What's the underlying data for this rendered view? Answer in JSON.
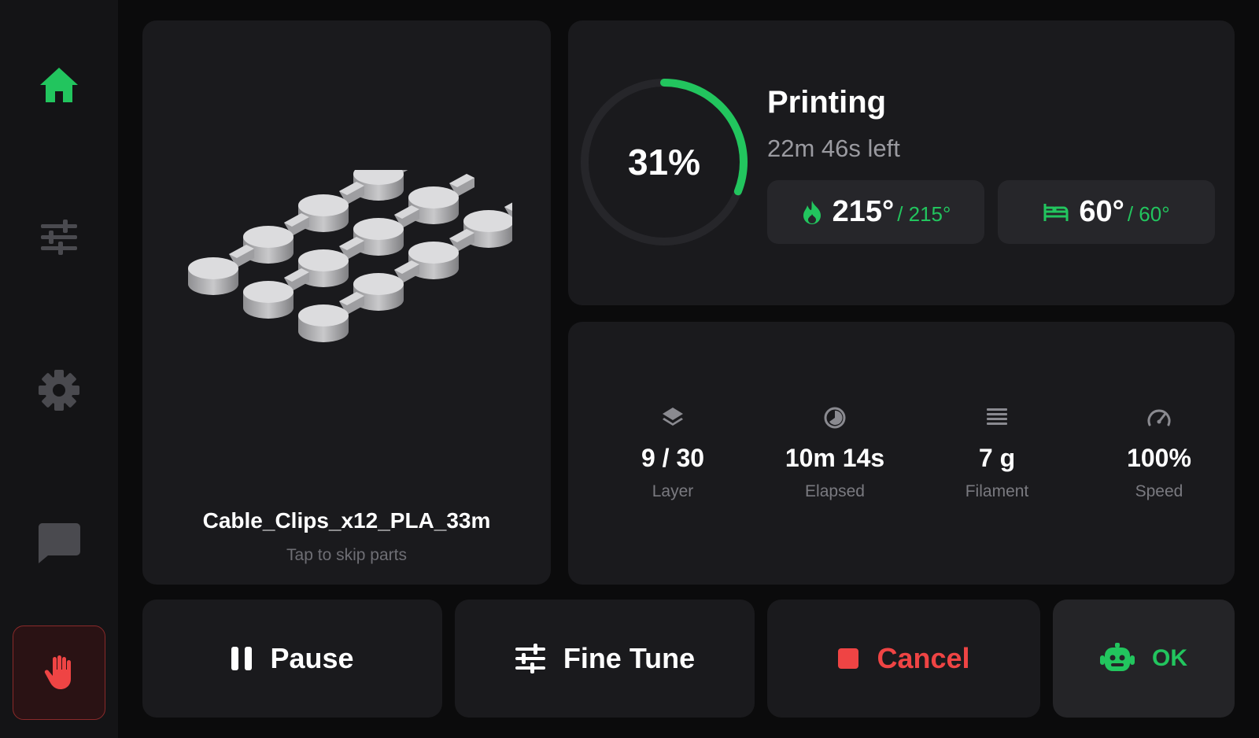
{
  "sidebar": {
    "items": [
      {
        "name": "home",
        "icon": "home-icon",
        "active": true
      },
      {
        "name": "tune",
        "icon": "sliders-icon",
        "active": false
      },
      {
        "name": "settings",
        "icon": "gear-icon",
        "active": false
      },
      {
        "name": "console",
        "icon": "chat-icon",
        "active": false
      }
    ],
    "estop_icon": "hand-stop-icon"
  },
  "job": {
    "filename": "Cable_Clips_x12_PLA_33m",
    "skip_hint": "Tap to skip parts",
    "thumbnail_icon": "model-preview"
  },
  "status": {
    "progress_percent": 31,
    "progress_label": "31%",
    "state": "Printing",
    "time_left": "22m 46s left"
  },
  "temps": {
    "nozzle": {
      "icon": "flame-icon",
      "current": "215°",
      "target": "/ 215°"
    },
    "bed": {
      "icon": "bed-icon",
      "current": "60°",
      "target": "/ 60°"
    }
  },
  "stats": [
    {
      "icon": "layers-icon",
      "value": "9 / 30",
      "label": "Layer"
    },
    {
      "icon": "clock-icon",
      "value": "10m 14s",
      "label": "Elapsed"
    },
    {
      "icon": "filament-icon",
      "value": "7 g",
      "label": "Filament"
    },
    {
      "icon": "speed-icon",
      "value": "100%",
      "label": "Speed"
    }
  ],
  "actions": {
    "pause": "Pause",
    "fine_tune": "Fine Tune",
    "cancel": "Cancel",
    "ok": "OK"
  },
  "colors": {
    "accent": "#22c55e",
    "danger": "#ef4444",
    "panel": "#1a1a1d",
    "background": "#0b0b0c"
  }
}
